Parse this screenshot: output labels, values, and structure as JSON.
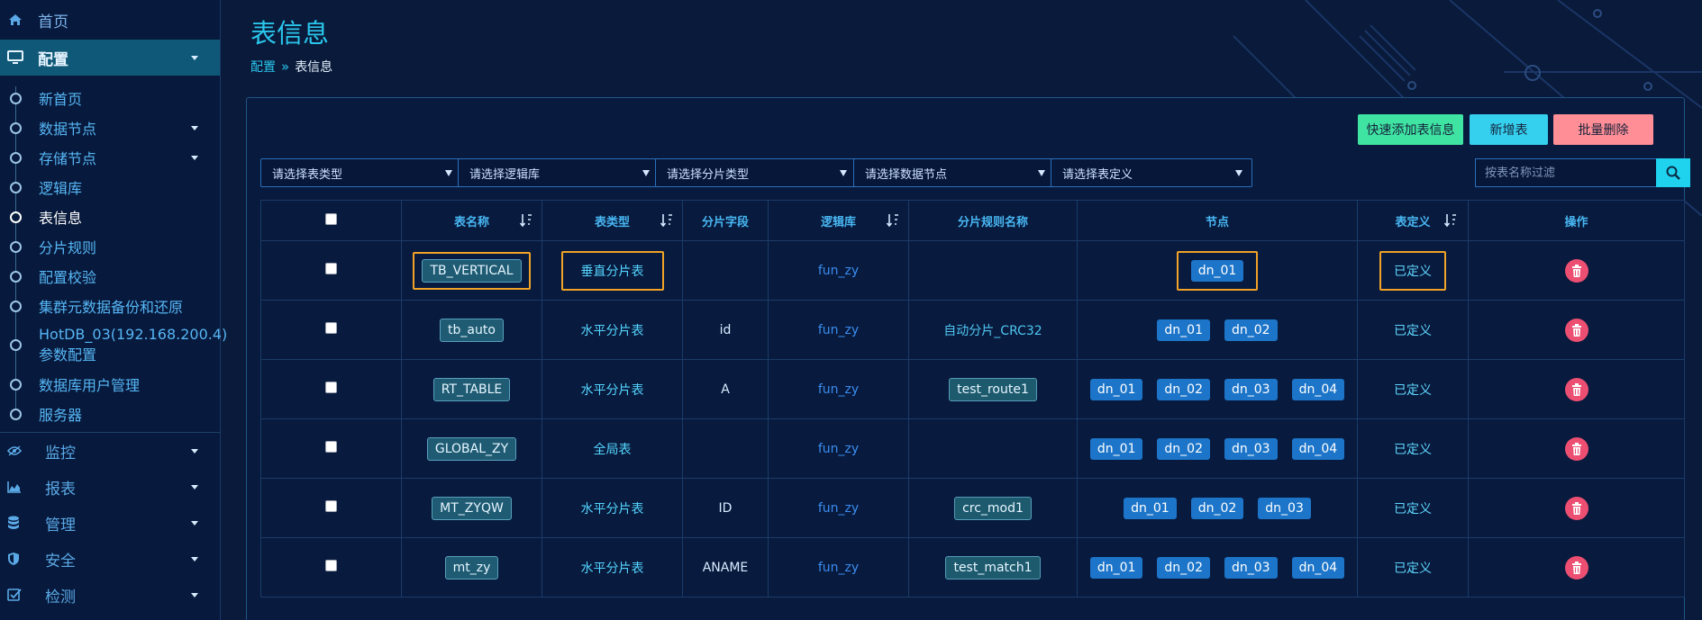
{
  "sidebar": {
    "home": "首页",
    "config": "配置",
    "config_items": [
      {
        "label": "新首页"
      },
      {
        "label": "数据节点"
      },
      {
        "label": "存储节点"
      },
      {
        "label": "逻辑库"
      },
      {
        "label": "表信息"
      },
      {
        "label": "分片规则"
      },
      {
        "label": "配置校验"
      },
      {
        "label": "集群元数据备份和还原"
      },
      {
        "label": "HotDB_03(192.168.200.4)参数配置"
      },
      {
        "label": "数据库用户管理"
      },
      {
        "label": "服务器"
      }
    ],
    "groups": [
      {
        "label": "监控"
      },
      {
        "label": "报表"
      },
      {
        "label": "管理"
      },
      {
        "label": "安全"
      },
      {
        "label": "检测"
      }
    ]
  },
  "page": {
    "title": "表信息",
    "breadcrumb": {
      "parent": "配置",
      "current": "表信息"
    }
  },
  "toolbar": {
    "quick_add": "快速添加表信息",
    "add": "新增表",
    "batch_delete": "批量删除"
  },
  "filters": {
    "table_type": "请选择表类型",
    "logic_db": "请选择逻辑库",
    "shard_type": "请选择分片类型",
    "data_node": "请选择数据节点",
    "table_def": "请选择表定义",
    "search_placeholder": "按表名称过滤"
  },
  "table": {
    "headers": {
      "name": "表名称",
      "type": "表类型",
      "shard_field": "分片字段",
      "logic_db": "逻辑库",
      "rule_name": "分片规则名称",
      "nodes": "节点",
      "definition": "表定义",
      "actions": "操作"
    },
    "rows": [
      {
        "name": "TB_VERTICAL",
        "type": "垂直分片表",
        "field": "",
        "db": "fun_zy",
        "rule": "",
        "nodes": [
          "dn_01"
        ],
        "def": "已定义",
        "highlight": true
      },
      {
        "name": "tb_auto",
        "type": "水平分片表",
        "field": "id",
        "db": "fun_zy",
        "rule": "自动分片_CRC32",
        "nodes": [
          "dn_01",
          "dn_02"
        ],
        "def": "已定义"
      },
      {
        "name": "RT_TABLE",
        "type": "水平分片表",
        "field": "A",
        "db": "fun_zy",
        "rule": "test_route1",
        "nodes": [
          "dn_01",
          "dn_02",
          "dn_03",
          "dn_04"
        ],
        "def": "已定义"
      },
      {
        "name": "GLOBAL_ZY",
        "type": "全局表",
        "field": "",
        "db": "fun_zy",
        "rule": "",
        "nodes": [
          "dn_01",
          "dn_02",
          "dn_03",
          "dn_04"
        ],
        "def": "已定义"
      },
      {
        "name": "MT_ZYQW",
        "type": "水平分片表",
        "field": "ID",
        "db": "fun_zy",
        "rule": "crc_mod1",
        "nodes": [
          "dn_01",
          "dn_02",
          "dn_03"
        ],
        "def": "已定义"
      },
      {
        "name": "mt_zy",
        "type": "水平分片表",
        "field": "ANAME",
        "db": "fun_zy",
        "rule": "test_match1",
        "nodes": [
          "dn_01",
          "dn_02",
          "dn_03",
          "dn_04"
        ],
        "def": "已定义"
      }
    ]
  },
  "colors": {
    "background": "#0a1a3a",
    "accent": "#2ac6ec",
    "highlight": "#f0a326",
    "danger": "#ec4f72",
    "node": "#1d75c9"
  }
}
